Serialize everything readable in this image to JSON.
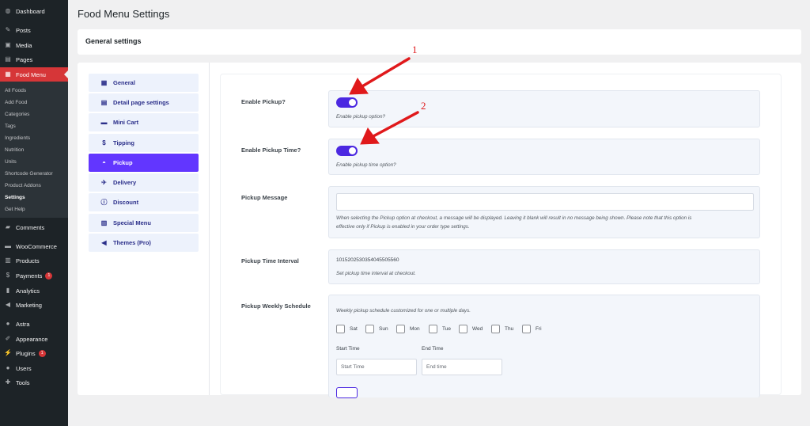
{
  "sidebar": {
    "items": [
      {
        "label": "Dashboard",
        "icon": "dashboard-icon"
      },
      {
        "label": "Posts",
        "icon": "pin-icon"
      },
      {
        "label": "Media",
        "icon": "media-icon"
      },
      {
        "label": "Pages",
        "icon": "pages-icon"
      },
      {
        "label": "Food Menu",
        "icon": "food-menu-icon"
      },
      {
        "label": "Comments",
        "icon": "comments-icon"
      },
      {
        "label": "WooCommerce",
        "icon": "woocommerce-icon"
      },
      {
        "label": "Products",
        "icon": "products-icon"
      },
      {
        "label": "Payments",
        "icon": "payments-icon",
        "badge": "1"
      },
      {
        "label": "Analytics",
        "icon": "analytics-icon"
      },
      {
        "label": "Marketing",
        "icon": "marketing-icon"
      },
      {
        "label": "Astra",
        "icon": "astra-icon"
      },
      {
        "label": "Appearance",
        "icon": "appearance-icon"
      },
      {
        "label": "Plugins",
        "icon": "plugins-icon",
        "badge": "1"
      },
      {
        "label": "Users",
        "icon": "users-icon"
      },
      {
        "label": "Tools",
        "icon": "tools-icon"
      }
    ],
    "submenu": [
      "All Foods",
      "Add Food",
      "Categories",
      "Tags",
      "Ingredients",
      "Nutrition",
      "Units",
      "Shortcode Generator",
      "Product Addons",
      "Settings",
      "Get Help"
    ]
  },
  "page": {
    "title": "Food Menu Settings",
    "section_title": "General settings"
  },
  "tabs": [
    {
      "label": "General",
      "icon": "grid-icon"
    },
    {
      "label": "Detail page settings",
      "icon": "document-icon"
    },
    {
      "label": "Mini Cart",
      "icon": "cart-icon"
    },
    {
      "label": "Tipping",
      "icon": "dollar-icon"
    },
    {
      "label": "Pickup",
      "icon": "car-icon",
      "active": true
    },
    {
      "label": "Delivery",
      "icon": "plane-icon"
    },
    {
      "label": "Discount",
      "icon": "info-icon"
    },
    {
      "label": "Special Menu",
      "icon": "menu-table-icon"
    },
    {
      "label": "Themes (Pro)",
      "icon": "megaphone-icon"
    }
  ],
  "settings": {
    "enable_pickup": {
      "label": "Enable Pickup?",
      "help": "Enable pickup option?",
      "enabled": true
    },
    "enable_pickup_time": {
      "label": "Enable Pickup Time?",
      "help": "Enable pickup time option?",
      "enabled": true
    },
    "pickup_message": {
      "label": "Pickup Message",
      "value": "",
      "help_line1": "When selecting the Pickup option at checkout, a message will be displayed. Leaving it blank will result in no message being shown. Please note that this option is",
      "help_line2": "effective only if Pickup is enabled in your order type settings."
    },
    "pickup_time_interval": {
      "label": "Pickup Time Interval",
      "value": "1015202530354045505560",
      "help": "Set pickup time interval at checkout."
    },
    "pickup_weekly_schedule": {
      "label": "Pickup Weekly Schedule",
      "help": "Weekly pickup schedule customized for one or multiple days.",
      "days": [
        "Sat",
        "Sun",
        "Mon",
        "Tue",
        "Wed",
        "Thu",
        "Fri"
      ],
      "start_time_label": "Start Time",
      "start_time_placeholder": "Start Time",
      "end_time_label": "End Time",
      "end_time_placeholder": "End time"
    }
  },
  "annotations": {
    "marker1": "1",
    "marker2": "2",
    "color": "#e0191b"
  },
  "colors": {
    "accent": "#6236ff",
    "toggle": "#4b28e1",
    "admin_bar": "#1d2327",
    "admin_current": "#d63638"
  }
}
